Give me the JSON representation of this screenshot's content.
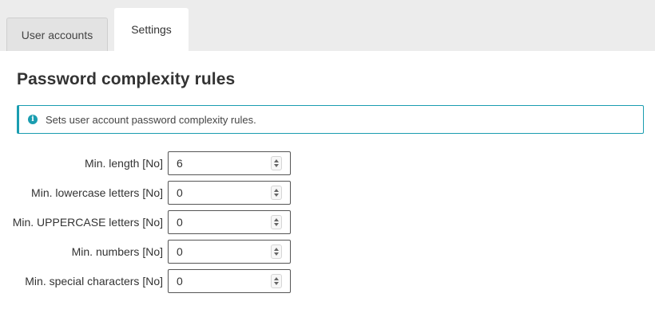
{
  "tabs": [
    {
      "label": "User accounts",
      "active": false
    },
    {
      "label": "Settings",
      "active": true
    }
  ],
  "page_title": "Password complexity rules",
  "info": {
    "icon": "info-icon",
    "text": "Sets user account password complexity rules."
  },
  "fields": [
    {
      "label": "Min. length [No]",
      "value": "6"
    },
    {
      "label": "Min. lowercase letters [No]",
      "value": "0"
    },
    {
      "label": "Min. UPPERCASE letters [No]",
      "value": "0"
    },
    {
      "label": "Min. numbers [No]",
      "value": "0"
    },
    {
      "label": "Min. special characters [No]",
      "value": "0"
    }
  ],
  "colors": {
    "accent": "#1a9db0",
    "tabbar_background": "#ececec"
  }
}
